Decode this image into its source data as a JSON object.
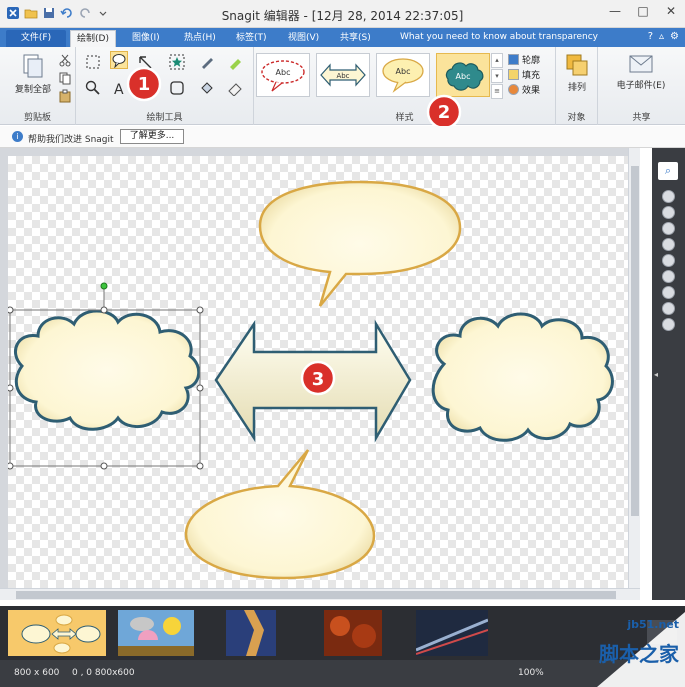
{
  "titlebar": {
    "title": "Snagit 编辑器 - [12月 28, 2014 22:37:05]",
    "window_buttons": [
      "—",
      "□",
      "✕"
    ]
  },
  "tabs": {
    "file": "文件(F)",
    "items": [
      "绘制(D)",
      "图像(I)",
      "热点(H)",
      "标签(T)",
      "视图(V)",
      "共享(S)"
    ],
    "active_index": 0,
    "help_text": "What you need to know about transparency"
  },
  "ribbon": {
    "clipboard": {
      "label": "剪贴板",
      "copy_all": "复制全部"
    },
    "drawing_tools": {
      "label": "绘制工具"
    },
    "styles": {
      "label": "样式",
      "sample": "Abc"
    },
    "props": {
      "outline": "轮廓",
      "fill": "填充",
      "effects": "效果"
    },
    "object": {
      "label": "对象",
      "arrange": "排列"
    },
    "share": {
      "label": "共享",
      "email": "电子邮件(E)"
    }
  },
  "infobar": {
    "text": "帮助我们改进 Snagit",
    "button": "了解更多..."
  },
  "markers": [
    "1",
    "2",
    "3"
  ],
  "status": {
    "size": "800 x 600",
    "pos": "0 , 0  800x600",
    "zoom": "100%"
  },
  "watermark": {
    "site": "jb51.net",
    "name": "脚本之家"
  },
  "colors": {
    "tab_blue": "#3d7cc9",
    "shape_fill": "#fdf6d3",
    "cloud_stroke": "#2f5e73",
    "bubble_stroke": "#d9a845",
    "marker_red": "#d9302a"
  }
}
